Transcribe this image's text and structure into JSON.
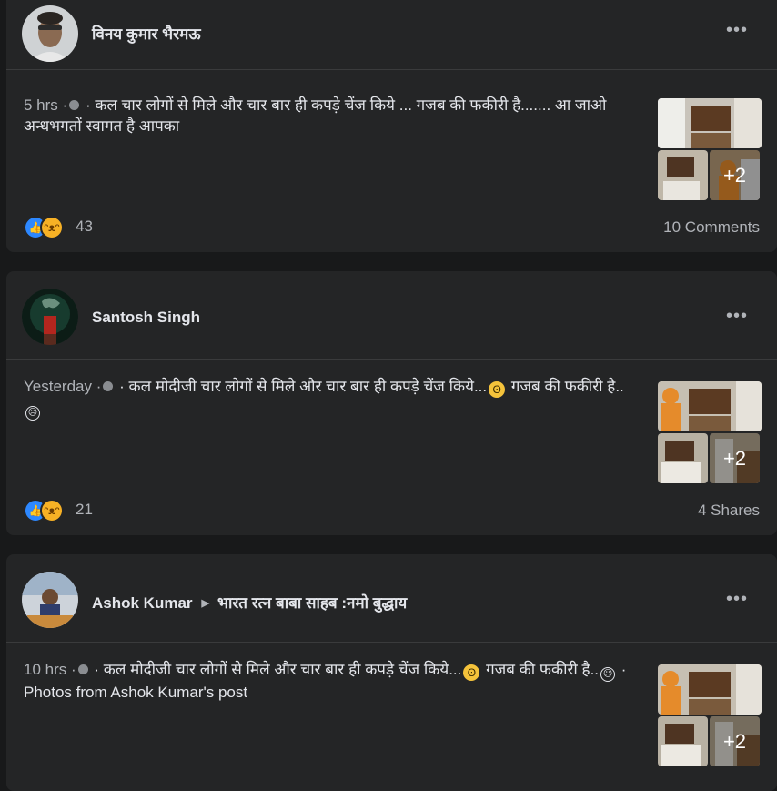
{
  "posts": [
    {
      "author": "विनय कुमार भैरमऊ",
      "time": "5 hrs",
      "meta_sep": "·",
      "text": "· कल चार लोगों से मिले और चार बार ही कपड़े चेंज किये ... गजब की फकीरी है....... आ जाओ अन्धभगतों स्वागत है आपका",
      "photos_more": "+2",
      "reaction_count": "43",
      "stat": "10 Comments"
    },
    {
      "author": "Santosh Singh",
      "time": "Yesterday",
      "meta_sep": "·",
      "text_a": "· कल मोदीजी चार लोगों से मिले और चार बार ही कपड़े चेंज किये...",
      "text_b": " गजब की फकीरी है..",
      "photos_more": "+2",
      "reaction_count": "21",
      "stat": "4 Shares"
    },
    {
      "author": "Ashok Kumar",
      "group": "भारत रत्न बाबा साहब :नमो बुद्धाय",
      "time": "10 hrs",
      "meta_sep": "·",
      "text_a": "· कल मोदीजी चार लोगों से मिले और चार बार ही कपड़े चेंज किये...",
      "text_b": " गजब की फकीरी है..",
      "text_c": " · Photos from Ashok Kumar's post",
      "photos_more": "+2"
    }
  ],
  "icons": {
    "more": "more-options-icon",
    "privacy": "globe-icon",
    "like": "like-reaction-icon",
    "haha": "haha-reaction-icon",
    "eyeroll": "eyeroll-emoji-icon",
    "sad": "sad-emoji-icon"
  },
  "colors": {
    "background": "#18191a",
    "card": "#242526",
    "like_blue": "#2d88ff",
    "haha_yellow": "#f7b125",
    "secondary_text": "#b0b3b8"
  }
}
